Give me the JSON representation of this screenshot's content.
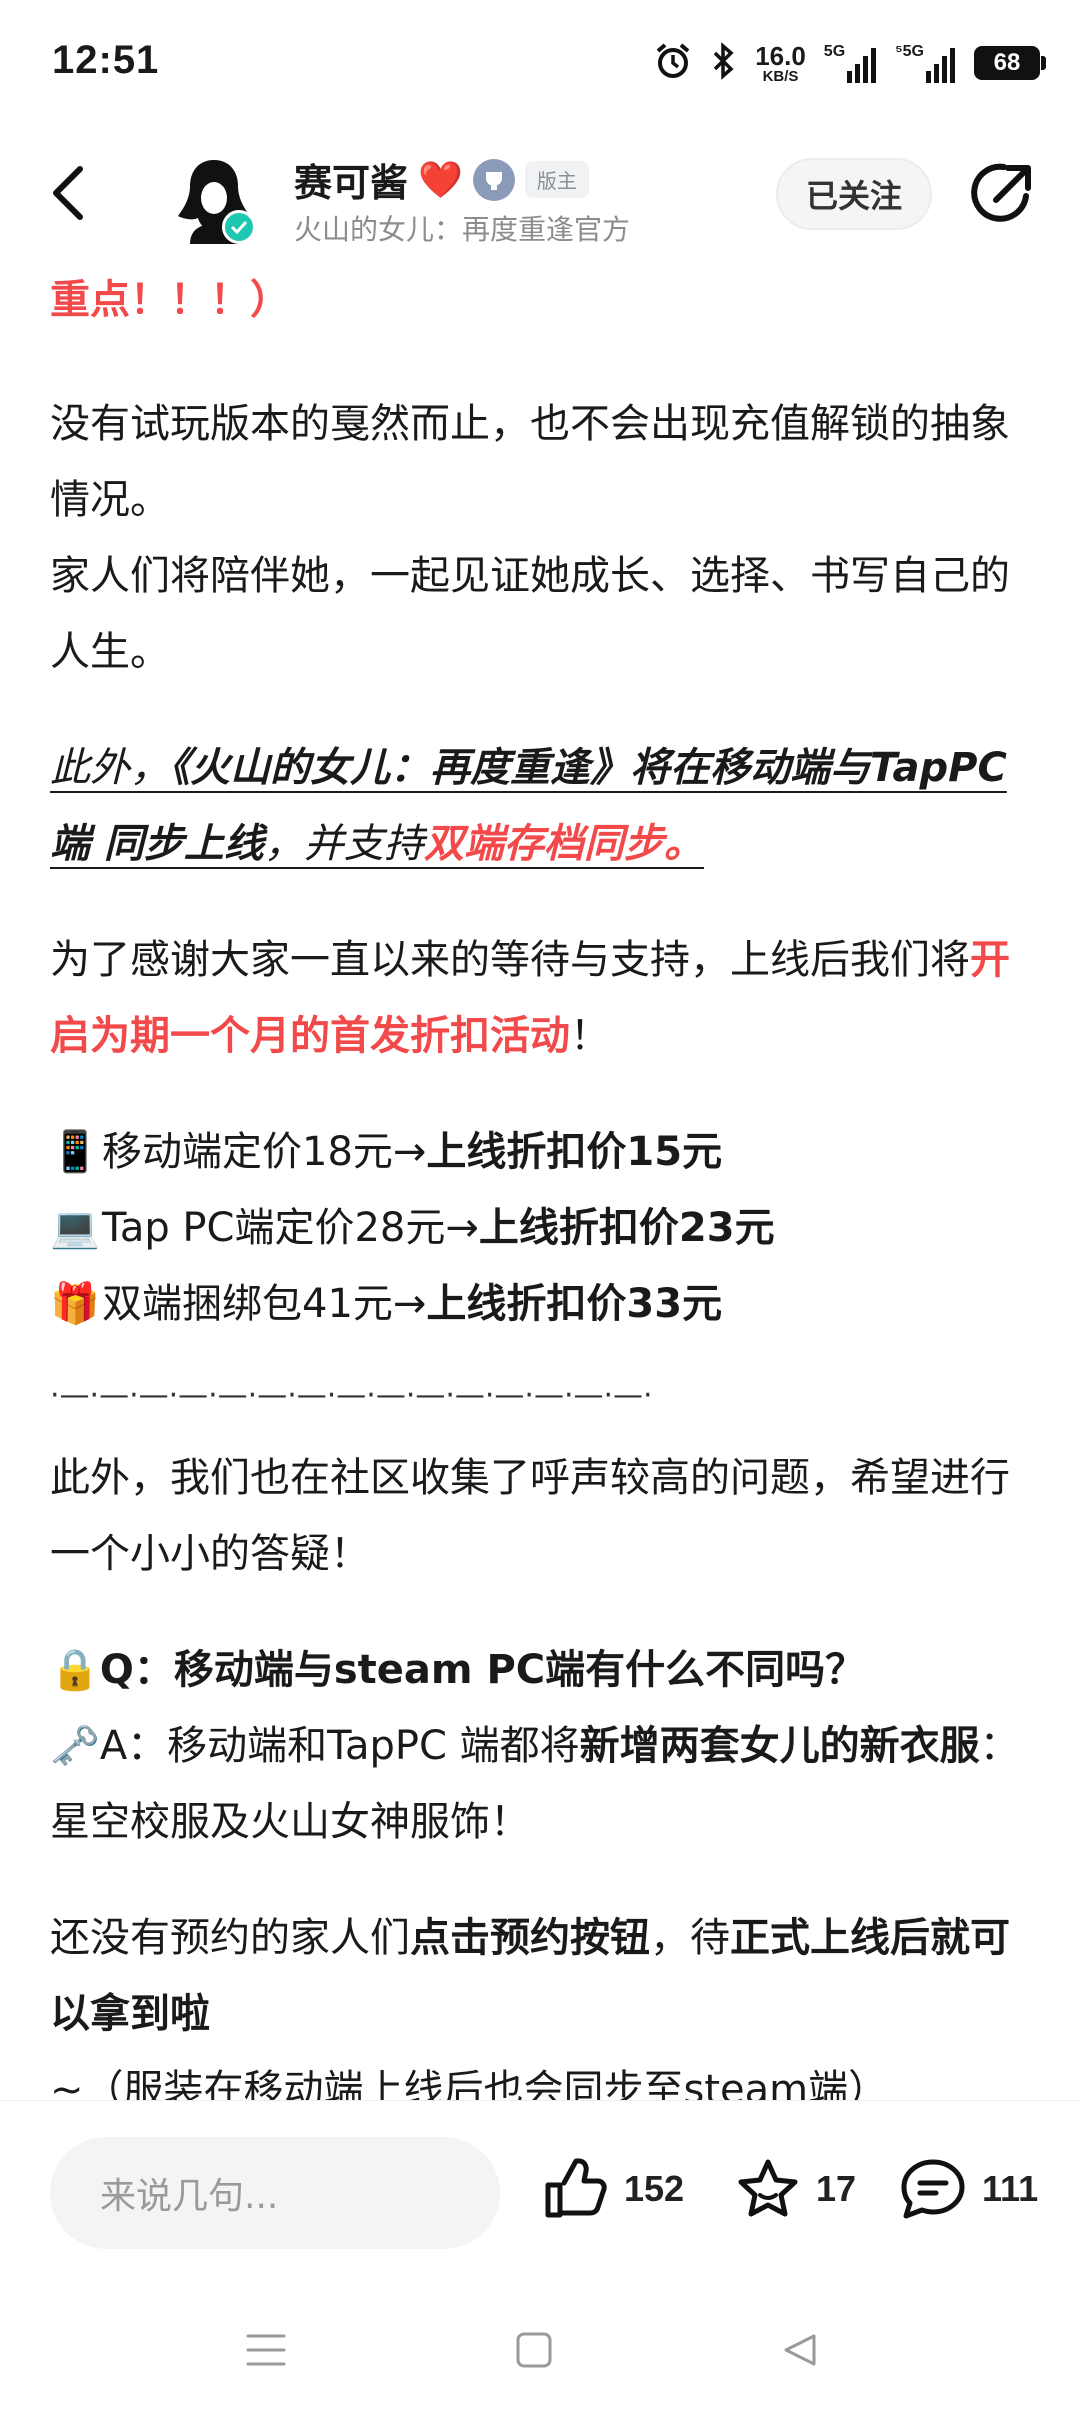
{
  "status_bar": {
    "time": "12:51",
    "net_speed_value": "16.0",
    "net_speed_unit": "KB/S",
    "signal1_tag": "5G",
    "signal2_tag": "⁵5G",
    "battery": "68"
  },
  "header": {
    "user_name": "赛可酱",
    "heart": "❤️",
    "mod_badge": "版主",
    "subtitle": "火山的女儿：再度重逢官方",
    "follow_label": "已关注"
  },
  "article": {
    "p0": "重点！！！）",
    "p1_line1": "没有试玩版本的戛然而止，也不会出现充值解锁的抽象情况。",
    "p1_line2": "家人们将陪伴她，一起见证她成长、选择、书写自己的人生。",
    "p2_a": "此外，",
    "p2_b": "《火山的女儿：再度重逢》将在移动端与TapPC 端 同步上线",
    "p2_c": "，并支持",
    "p2_d": "双端存档同步。",
    "p3_a": "为了感谢大家一直以来的等待与支持，上线后我们将",
    "p3_b": "开启为期一个月的首发折扣活动",
    "p3_c": "！",
    "price_items": [
      {
        "emoji": "📱",
        "text": "移动端定价18元→",
        "bold": "上线折扣价15元"
      },
      {
        "emoji": "💻",
        "text": "Tap PC端定价28元→",
        "bold": "上线折扣价23元"
      },
      {
        "emoji": "🎁",
        "text": "双端捆绑包41元→",
        "bold": "上线折扣价33元"
      }
    ],
    "divider": "·—·—·—·—·—·—·—·—·—·—·—·—·—·—·—·",
    "p4": "此外，我们也在社区收集了呼声较高的问题，希望进行一个小小的答疑！",
    "q_emoji": "🔒",
    "q_text": "Q：移动端与steam PC端有什么不同吗？",
    "a_emoji": "🗝️",
    "a_text1": "A：移动端和TapPC 端都将",
    "a_bold": "新增两套女儿的新衣服",
    "a_text2": "：星空校服及火山女神服饰！",
    "p6_a": "还没有预约的家人们",
    "p6_b": "点击预约按钮",
    "p6_c": "，待",
    "p6_d": "正式上线后就可以拿到啦",
    "p6_e": "~（服装在移动端上线后也会同步至steam端）"
  },
  "bottom_bar": {
    "comment_placeholder": "来说几句...",
    "like_count": "152",
    "favorite_count": "17",
    "comment_count": "111"
  },
  "colors": {
    "accent_red": "#f24a4a",
    "verified_green": "#1ec8b0"
  }
}
